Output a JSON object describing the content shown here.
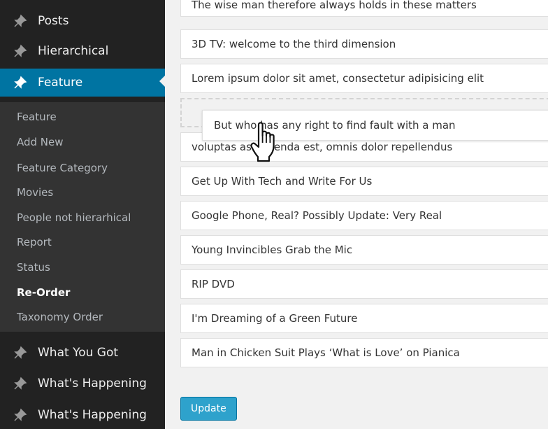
{
  "sidebar": {
    "top_items": [
      {
        "label": "Posts"
      },
      {
        "label": "Hierarchical"
      },
      {
        "label": "Feature"
      }
    ],
    "submenu": [
      {
        "label": "Feature"
      },
      {
        "label": "Add New"
      },
      {
        "label": "Feature Category"
      },
      {
        "label": "Movies"
      },
      {
        "label": "People not hierarhical"
      },
      {
        "label": "Report"
      },
      {
        "label": "Status"
      },
      {
        "label": "Re-Order"
      },
      {
        "label": "Taxonomy Order"
      }
    ],
    "bottom_items": [
      {
        "label": "What You Got"
      },
      {
        "label": "What's Happening"
      },
      {
        "label": "What's Happening"
      }
    ]
  },
  "list": {
    "items_before": [
      "The wise man therefore always holds in these matters",
      "3D TV: welcome to the third dimension",
      "Lorem ipsum dolor sit amet, consectetur adipisicing elit"
    ],
    "dragging_item": "But who has any right to find fault with a man",
    "items_after": [
      "voluptas assumenda est, omnis dolor repellendus",
      "Get Up With Tech and Write For Us",
      "Google Phone, Real? Possibly Update: Very Real",
      "Young Invincibles Grab the Mic",
      "RIP DVD",
      "I'm Dreaming of a Green Future",
      "Man in Chicken Suit Plays ‘What is Love’ on Pianica"
    ]
  },
  "update_button": {
    "label": "Update"
  },
  "colors": {
    "sidebar_bg": "#222222",
    "submenu_bg": "#333333",
    "active_bg": "#0074a2",
    "button_bg": "#2ea2cc"
  },
  "icons": {
    "menu": "pin-icon",
    "cursor": "hand-cursor-icon"
  }
}
